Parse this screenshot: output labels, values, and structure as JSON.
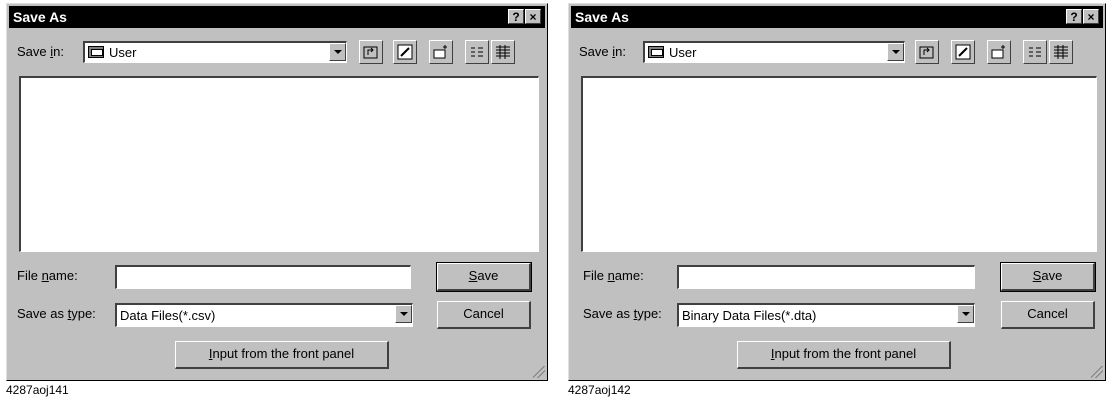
{
  "dialogs": [
    {
      "title": "Save As",
      "help_glyph": "?",
      "close_glyph": "×",
      "save_in_label_pre": "Save ",
      "save_in_label_u": "i",
      "save_in_label_post": "n:",
      "save_in_value": "User",
      "file_name_label_pre": "File ",
      "file_name_label_u": "n",
      "file_name_label_post": "ame:",
      "file_name_value": "",
      "save_as_type_label_pre": "Save as ",
      "save_as_type_label_u": "t",
      "save_as_type_label_post": "ype:",
      "save_as_type_value": "Data Files(*.csv)",
      "save_button_u": "S",
      "save_button_rest": "ave",
      "cancel_button": "Cancel",
      "front_panel_button_u": "I",
      "front_panel_button_rest": "nput from the front panel",
      "caption": "4287aoj141"
    },
    {
      "title": "Save As",
      "help_glyph": "?",
      "close_glyph": "×",
      "save_in_label_pre": "Save ",
      "save_in_label_u": "i",
      "save_in_label_post": "n:",
      "save_in_value": "User",
      "file_name_label_pre": "File ",
      "file_name_label_u": "n",
      "file_name_label_post": "ame:",
      "file_name_value": "",
      "save_as_type_label_pre": "Save as ",
      "save_as_type_label_u": "t",
      "save_as_type_label_post": "ype:",
      "save_as_type_value": "Binary Data Files(*.dta)",
      "save_button_u": "S",
      "save_button_rest": "ave",
      "cancel_button": "Cancel",
      "front_panel_button_u": "I",
      "front_panel_button_rest": "nput from the front panel",
      "caption": "4287aoj142"
    }
  ],
  "toolbar_icons": [
    "up-one-level-icon",
    "desktop-icon",
    "new-folder-icon",
    "list-view-icon",
    "details-view-icon"
  ]
}
